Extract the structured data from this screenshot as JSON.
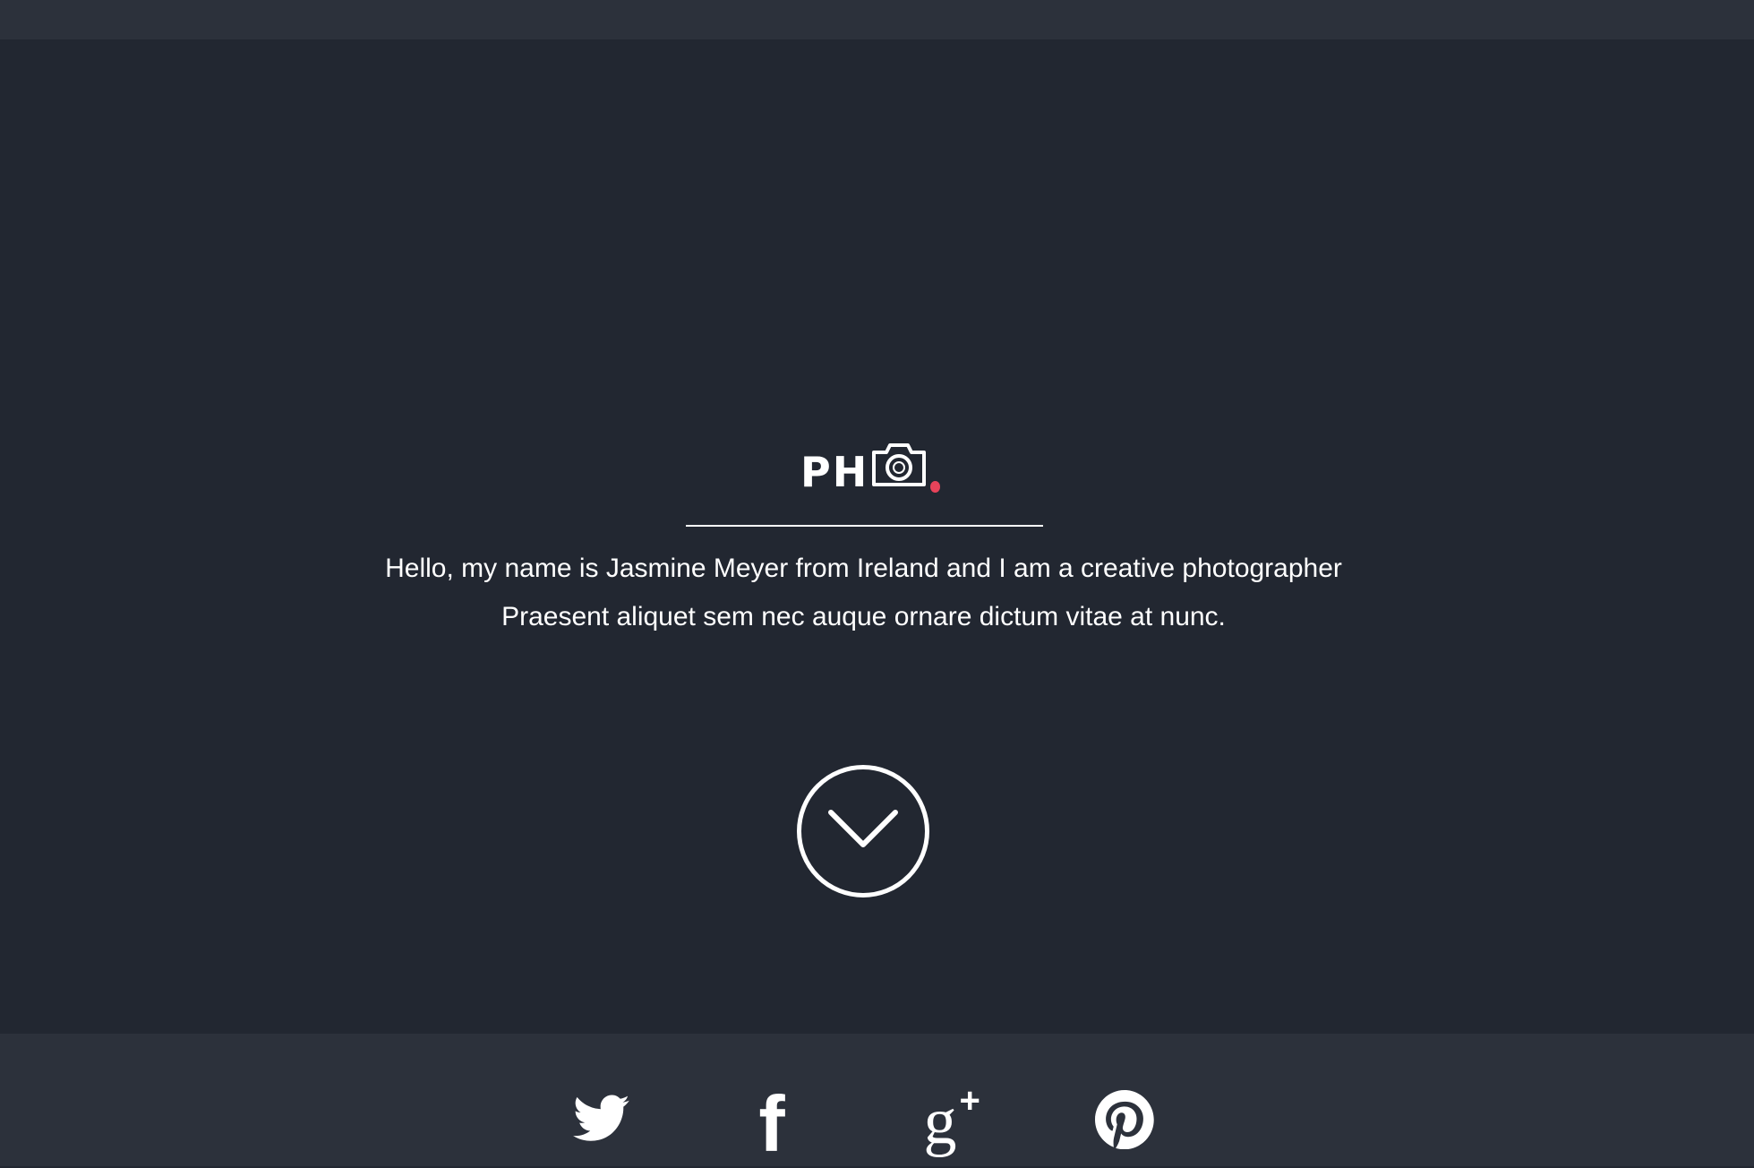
{
  "logo": {
    "text": "PH",
    "icon": "camera-icon",
    "accent_color": "#e8435a"
  },
  "hero": {
    "line1": "Hello, my name is Jasmine Meyer from Ireland and I am a creative photographer",
    "line2": "Praesent aliquet sem nec auque ornare dictum vitae at nunc.",
    "scroll_icon": "chevron-down-icon"
  },
  "social": [
    {
      "name": "twitter",
      "icon": "twitter-icon"
    },
    {
      "name": "facebook",
      "icon": "facebook-icon",
      "glyph": "f"
    },
    {
      "name": "google-plus",
      "icon": "google-plus-icon",
      "glyph": "g",
      "plus": "+"
    },
    {
      "name": "pinterest",
      "icon": "pinterest-icon"
    }
  ],
  "colors": {
    "background": "#222731",
    "bar": "#2c313b",
    "text": "#ffffff"
  }
}
